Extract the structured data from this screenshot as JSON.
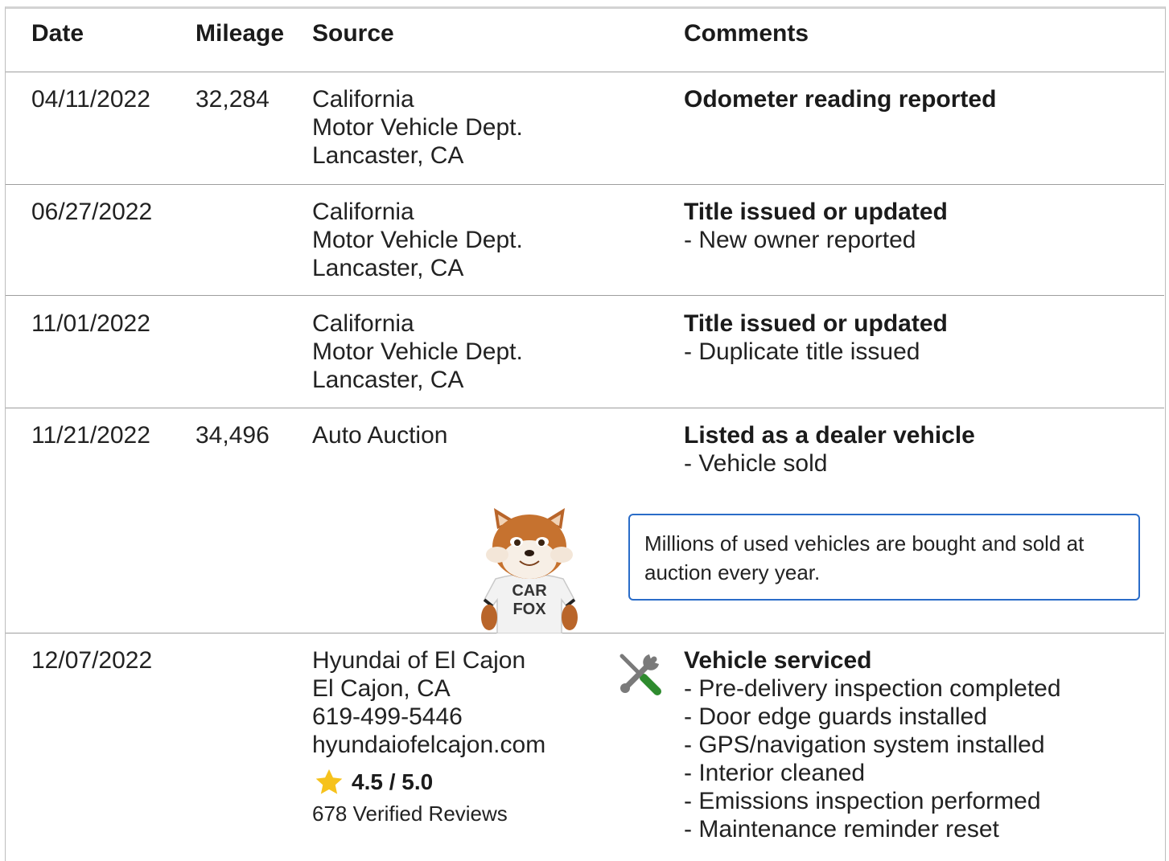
{
  "table": {
    "headers": {
      "date": "Date",
      "mileage": "Mileage",
      "source": "Source",
      "comments": "Comments"
    },
    "rows": [
      {
        "date": "04/11/2022",
        "mileage": "32,284",
        "source": [
          "California",
          "Motor Vehicle Dept.",
          "Lancaster, CA"
        ],
        "comment_title": "Odometer reading reported",
        "comment_items": []
      },
      {
        "date": "06/27/2022",
        "mileage": "",
        "source": [
          "California",
          "Motor Vehicle Dept.",
          "Lancaster, CA"
        ],
        "comment_title": "Title issued or updated",
        "comment_items": [
          "New owner reported"
        ]
      },
      {
        "date": "11/01/2022",
        "mileage": "",
        "source": [
          "California",
          "Motor Vehicle Dept.",
          "Lancaster, CA"
        ],
        "comment_title": "Title issued or updated",
        "comment_items": [
          "Duplicate title issued"
        ]
      },
      {
        "date": "11/21/2022",
        "mileage": "34,496",
        "source": [
          "Auto Auction"
        ],
        "comment_title": "Listed as a dealer vehicle",
        "comment_items": [
          "Vehicle sold"
        ],
        "callout": "Millions of used vehicles are bought and sold at auction every year.",
        "mascot_shirt": [
          "CAR",
          "FOX"
        ]
      },
      {
        "date": "12/07/2022",
        "mileage": "",
        "source": [
          "Hyundai of El Cajon",
          "El Cajon, CA",
          "619-499-5446",
          "hyundaiofelcajon.com"
        ],
        "rating": "4.5 / 5.0",
        "reviews": "678 Verified Reviews",
        "comment_title": "Vehicle serviced",
        "comment_items": [
          "Pre-delivery inspection completed",
          "Door edge guards installed",
          "GPS/navigation system installed",
          "Interior cleaned",
          "Emissions inspection performed",
          "Maintenance reminder reset"
        ],
        "icon": "service-wrench-icon"
      }
    ]
  },
  "colors": {
    "callout_border": "#2a6cc8",
    "star": "#f6c21c",
    "wrench_gray": "#7a7a7a",
    "wrench_green": "#2e8b2e"
  }
}
